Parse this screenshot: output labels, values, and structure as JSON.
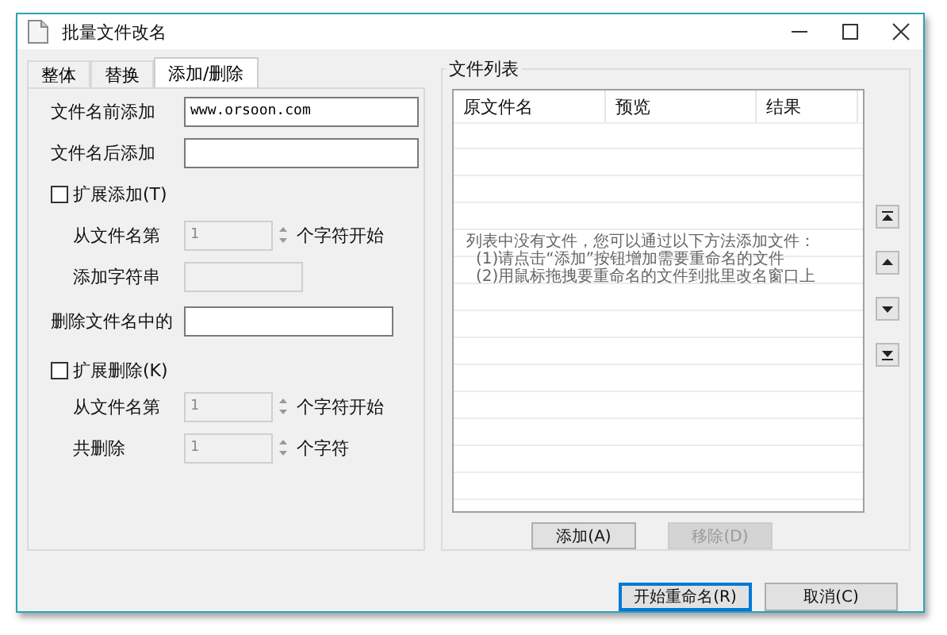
{
  "window": {
    "title": "批量文件改名"
  },
  "tabs": [
    {
      "label": "整体",
      "selected": false
    },
    {
      "label": "替换",
      "selected": false
    },
    {
      "label": "添加/删除",
      "selected": true
    }
  ],
  "add_prefix": {
    "label": "文件名前添加",
    "value": "www.orsoon.com"
  },
  "add_suffix": {
    "label": "文件名后添加"
  },
  "extend_add": {
    "label": "扩展添加(T)",
    "checked": false,
    "from_label": "从文件名第",
    "from_value": "1",
    "from_unit": "个字符开始",
    "string_label": "添加字符串",
    "disabled": true
  },
  "delete_text": {
    "label": "删除文件名中的"
  },
  "extend_delete": {
    "label": "扩展删除(K)",
    "checked": false,
    "from_label": "从文件名第",
    "from_value": "1",
    "from_unit": "个字符开始",
    "count_label": "共删除",
    "count_value": "1",
    "count_unit": "个字符",
    "disabled": true
  },
  "file_list": {
    "title": "文件列表",
    "columns": [
      "原文件名",
      "预览",
      "结果"
    ],
    "empty_message": [
      "列表中没有文件，您可以通过以下方法添加文件：",
      "(1)请点击“添加”按钮增加需要重命名的文件",
      "(2)用鼠标拖拽要重命名的文件到批里改名窗口上"
    ],
    "buttons": [
      {
        "label": "添加(A)",
        "disabled": false
      },
      {
        "label": "移除(D)",
        "disabled": true
      }
    ]
  },
  "buttons": [
    {
      "label": "开始重命名(R)",
      "default": true
    },
    {
      "label": "取消(C)",
      "default": false
    }
  ]
}
